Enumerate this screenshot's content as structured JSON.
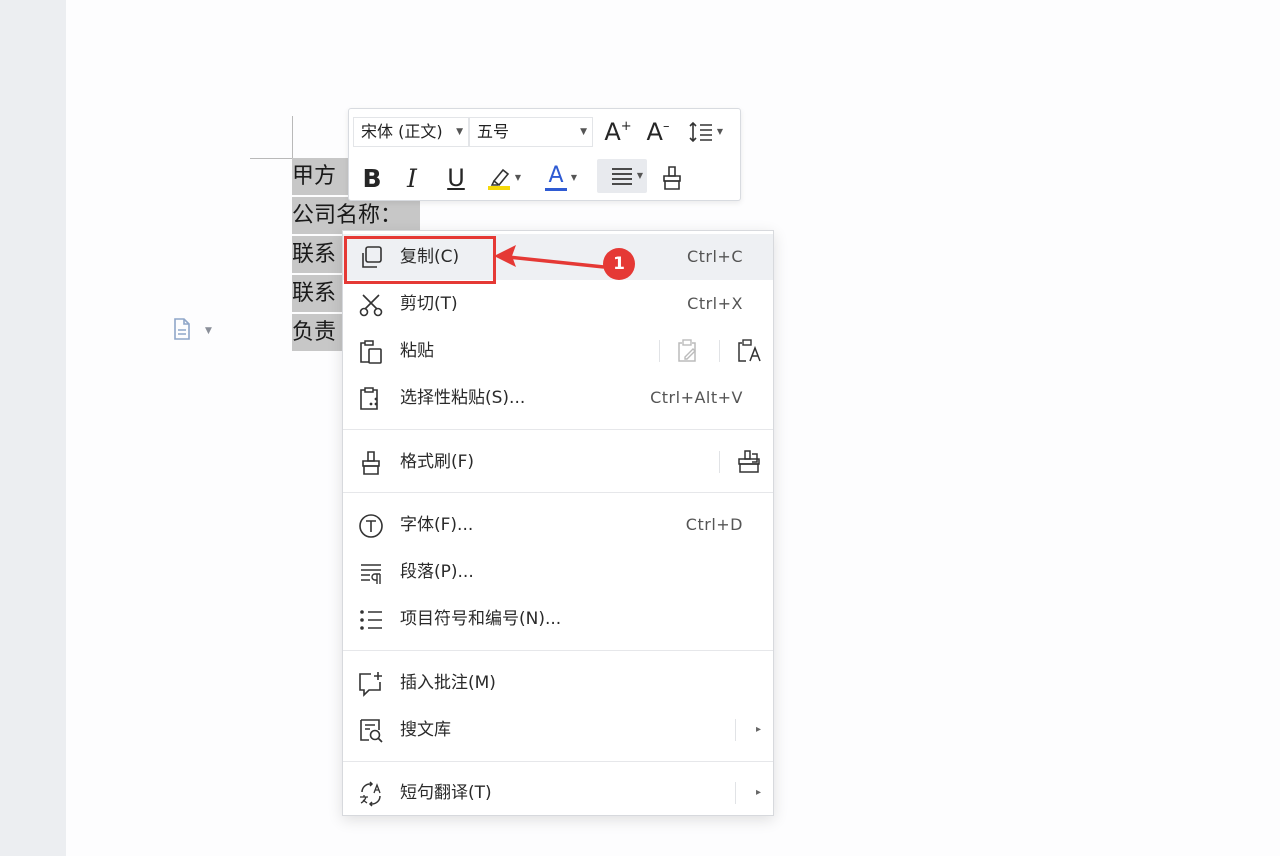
{
  "document": {
    "lines": [
      "甲方",
      "公司名称：",
      "联系",
      "联系",
      "负责"
    ]
  },
  "toolbar": {
    "font_name": "宋体 (正文)",
    "font_size": "五号",
    "buttons": {
      "grow_font": "A",
      "shrink_font": "A",
      "bold": "B",
      "italic": "I",
      "underline": "U",
      "font_color": "A"
    },
    "highlight_color": "#f5d80a",
    "font_color_value": "#2f5bd3"
  },
  "context_menu": {
    "items": [
      {
        "label": "复制(C)",
        "shortcut": "Ctrl+C"
      },
      {
        "label": "剪切(T)",
        "shortcut": "Ctrl+X"
      },
      {
        "label": "粘贴",
        "shortcut": ""
      },
      {
        "label": "选择性粘贴(S)...",
        "shortcut": "Ctrl+Alt+V"
      },
      {
        "label": "格式刷(F)",
        "shortcut": ""
      },
      {
        "label": "字体(F)...",
        "shortcut": "Ctrl+D"
      },
      {
        "label": "段落(P)...",
        "shortcut": ""
      },
      {
        "label": "项目符号和编号(N)...",
        "shortcut": ""
      },
      {
        "label": "插入批注(M)",
        "shortcut": ""
      },
      {
        "label": "搜文库",
        "shortcut": ""
      },
      {
        "label": "短句翻译(T)",
        "shortcut": ""
      }
    ],
    "submenu_arrow": "▸"
  },
  "annotation": {
    "step_number": "1",
    "color": "#e53935"
  }
}
